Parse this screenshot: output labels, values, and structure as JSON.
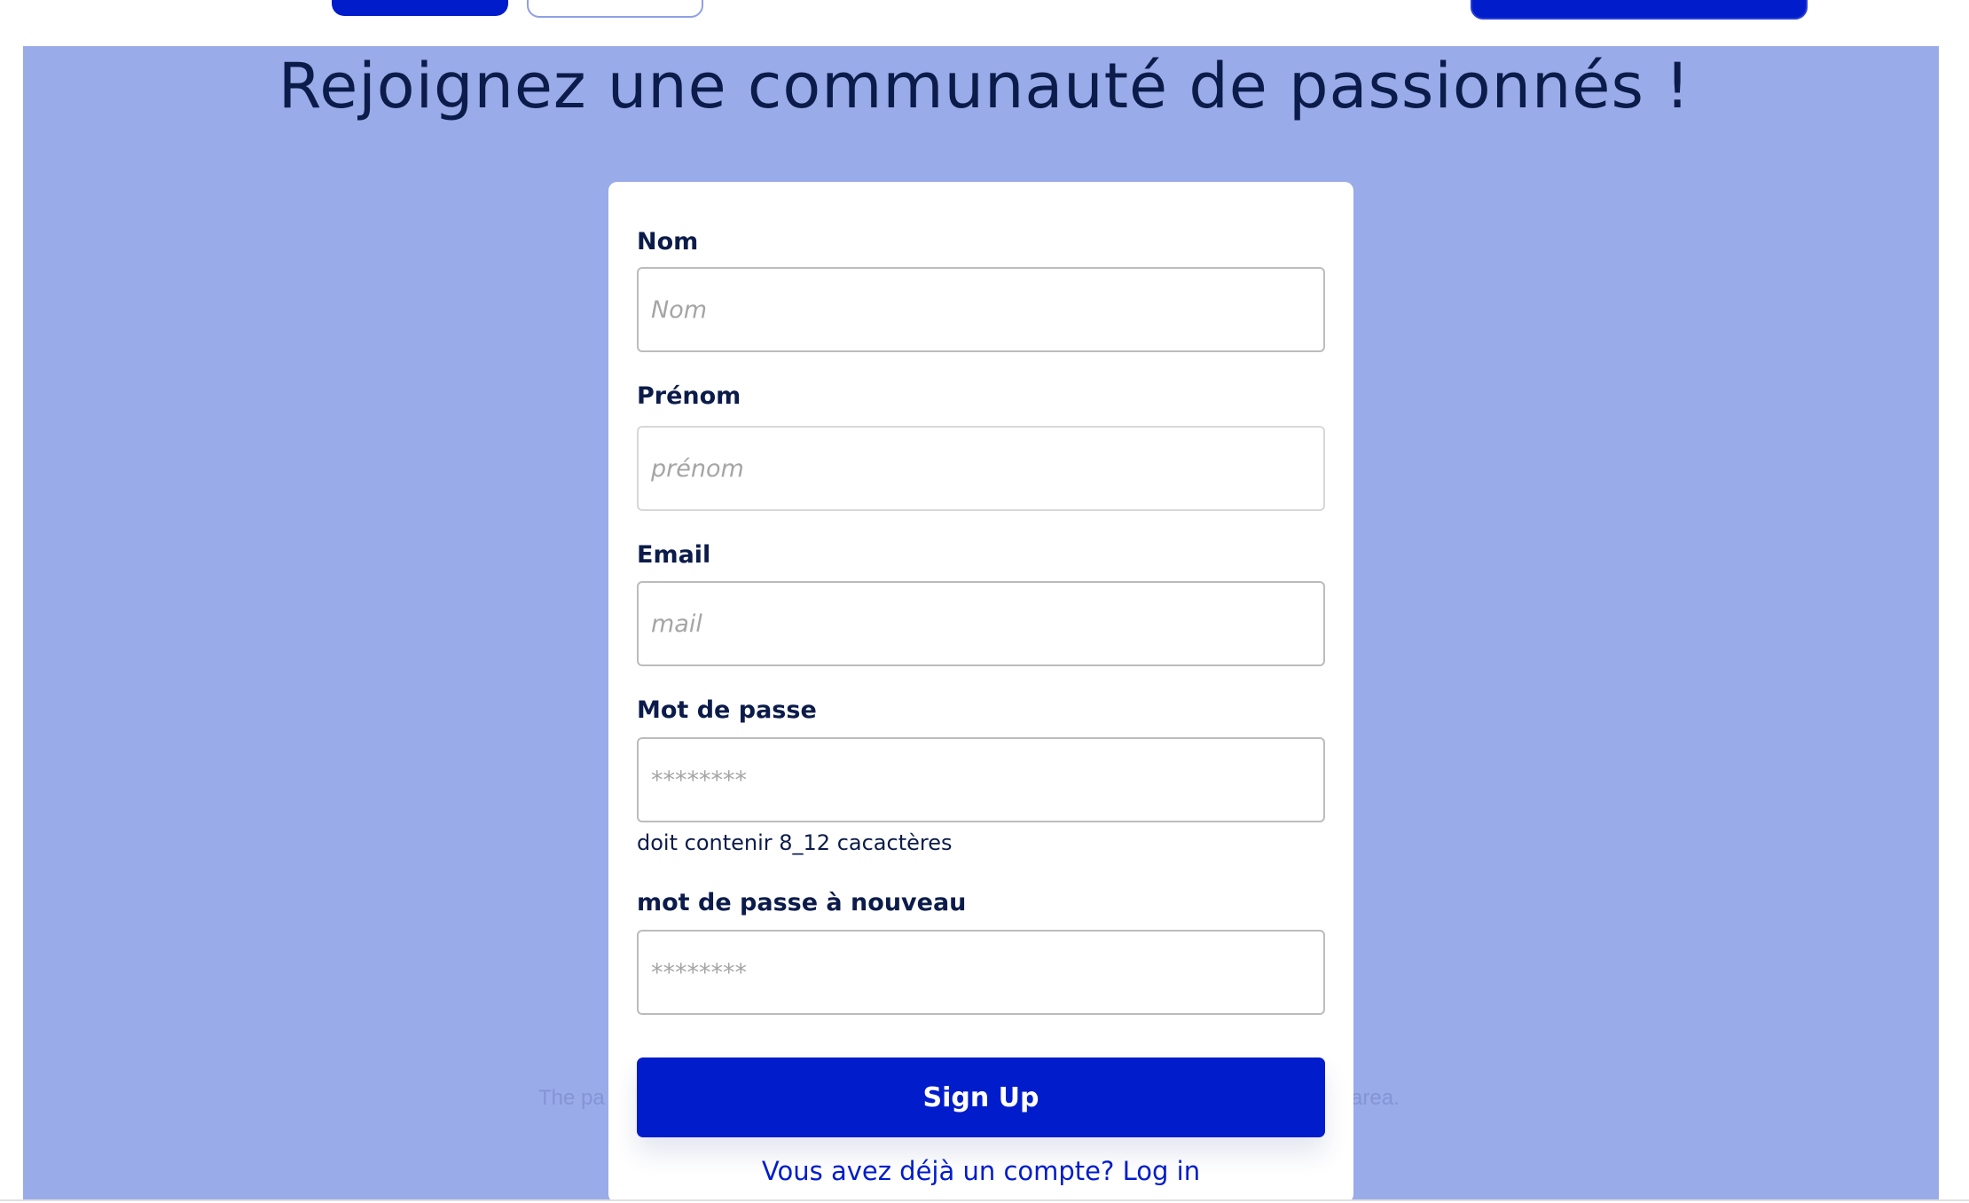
{
  "hero": {
    "title": "Rejoignez une communauté de passionnés !",
    "background_note_left": "The pa",
    "background_note_right": "e area."
  },
  "form": {
    "nom": {
      "label": "Nom",
      "placeholder": "Nom"
    },
    "prenom": {
      "label": "Prénom",
      "placeholder": "prénom"
    },
    "email": {
      "label": "Email",
      "placeholder": "mail"
    },
    "password": {
      "label": "Mot de passe",
      "placeholder": "********",
      "hint": "doit contenir 8_12 cacactères"
    },
    "password_repeat": {
      "label": "mot de passe à nouveau",
      "placeholder": "********"
    },
    "submit_label": "Sign Up",
    "login_link": "Vous avez déjà un compte? Log in"
  },
  "colors": {
    "accent": "#001ccb",
    "hero_background": "#9aabe9",
    "title_text": "#0c1c4a"
  }
}
